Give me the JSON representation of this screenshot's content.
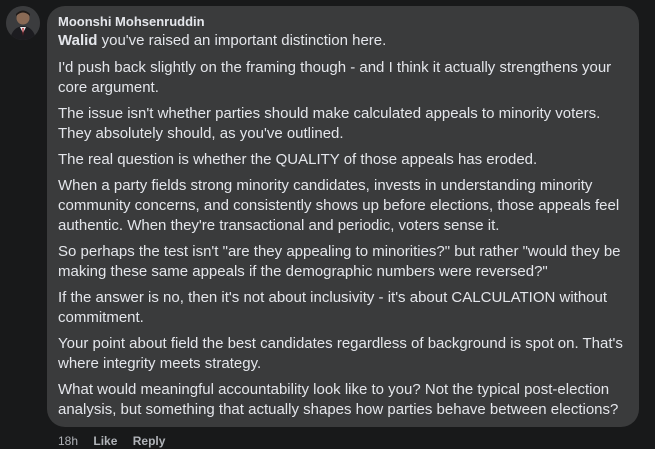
{
  "comment": {
    "author": "Moonshi Mohsenruddin",
    "mention": "Walid",
    "first_paragraph_rest": " you've raised an important distinction here.",
    "paragraphs": [
      "I'd push back slightly on the framing though - and I think it actually strengthens your core argument.",
      "The issue isn't whether parties should make calculated appeals to minority voters. They absolutely should, as you've outlined.",
      "The real question is whether the QUALITY of those appeals has eroded.",
      "When a party fields strong minority candidates, invests in understanding minority community concerns, and consistently shows up before elections, those appeals feel authentic. When they're transactional and periodic, voters sense it.",
      "So perhaps the test isn't \"are they appealing to minorities?\" but rather \"would they be making these same appeals if the demographic numbers were reversed?\"",
      "If the answer is no, then it's not about inclusivity - it's about CALCULATION without commitment.",
      "Your point about field the best candidates regardless of background is spot on. That's where integrity meets strategy.",
      "What would meaningful accountability look like to you? Not the typical post-election analysis, but something that actually shapes how parties behave between elections?"
    ],
    "timestamp": "18h",
    "like_label": "Like",
    "reply_label": "Reply"
  },
  "icons": {
    "avatar": "profile-photo"
  }
}
